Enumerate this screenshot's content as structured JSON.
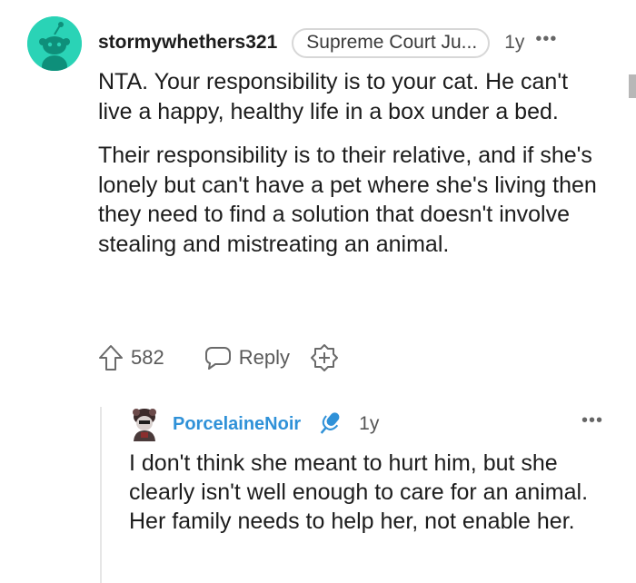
{
  "comment": {
    "username": "stormywhethers321",
    "flair": "Supreme Court Ju...",
    "time": "1y",
    "more": "•••",
    "paragraphs": [
      "NTA. Your responsibility is to your cat. He can't live a happy, healthy life in a box under a bed.",
      "Their responsibility is to their relative, and if she's lonely but can't have a pet where she's living then they need to find a solution that doesn't involve stealing and mistreating an animal."
    ],
    "votes": "582",
    "reply_label": "Reply",
    "icons": {
      "avatar": "snoo-avatar-icon",
      "upvote": "upvote-arrow-icon",
      "reply": "speech-bubble-icon",
      "award": "add-award-icon"
    },
    "avatar_color": "#2ad3b6"
  },
  "reply": {
    "username": "PorcelaineNoir",
    "time": "1y",
    "more": "•••",
    "paragraphs": [
      "I don't think she meant to hurt him, but she clearly isn't well enough to care for an animal. Her family needs to help her, not enable her."
    ],
    "icons": {
      "avatar": "custom-avatar-icon",
      "badge": "microphone-icon"
    },
    "username_color": "#2f91d8"
  }
}
